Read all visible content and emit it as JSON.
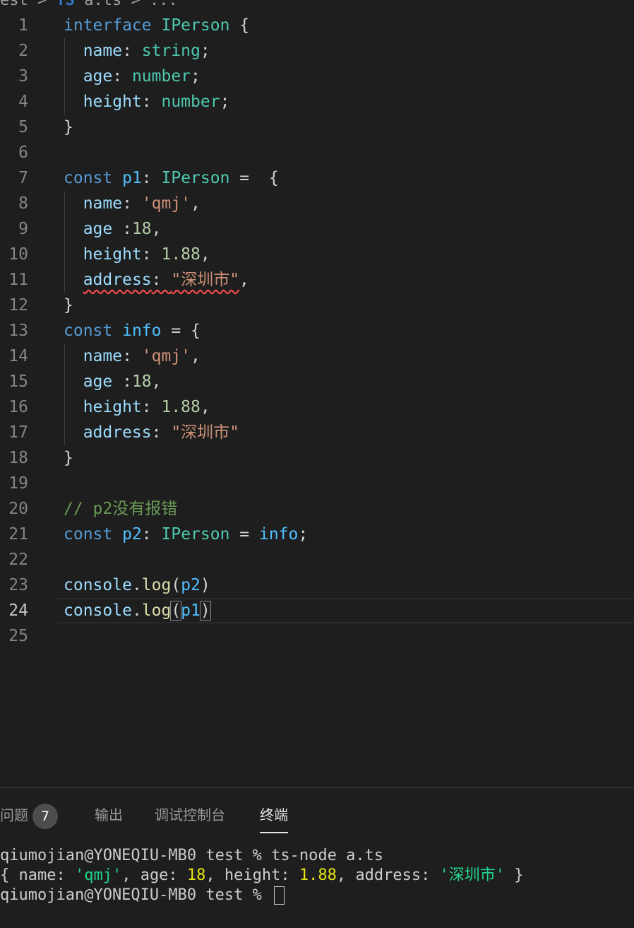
{
  "breadcrumb": {
    "folder": "est",
    "sep1": ">",
    "lang_icon": "TS",
    "file": "a.ts",
    "sep2": ">",
    "more": "..."
  },
  "editor": {
    "lines": [
      {
        "n": "1",
        "t": [
          [
            "kw",
            "interface "
          ],
          [
            "ty",
            "IPerson"
          ],
          [
            "pc",
            " {"
          ]
        ]
      },
      {
        "n": "2",
        "t": [
          [
            "pr",
            "  name"
          ],
          [
            "pc",
            ": "
          ],
          [
            "ty",
            "string"
          ],
          [
            "pc",
            ";"
          ]
        ]
      },
      {
        "n": "3",
        "t": [
          [
            "pr",
            "  age"
          ],
          [
            "pc",
            ": "
          ],
          [
            "ty",
            "number"
          ],
          [
            "pc",
            ";"
          ]
        ]
      },
      {
        "n": "4",
        "t": [
          [
            "pr",
            "  height"
          ],
          [
            "pc",
            ": "
          ],
          [
            "ty",
            "number"
          ],
          [
            "pc",
            ";"
          ]
        ]
      },
      {
        "n": "5",
        "t": [
          [
            "pc",
            "}"
          ]
        ]
      },
      {
        "n": "6",
        "t": []
      },
      {
        "n": "7",
        "t": [
          [
            "kw",
            "const "
          ],
          [
            "vr",
            "p1"
          ],
          [
            "pc",
            ": "
          ],
          [
            "ty",
            "IPerson"
          ],
          [
            "pc",
            " =  {"
          ]
        ]
      },
      {
        "n": "8",
        "t": [
          [
            "pr",
            "  name"
          ],
          [
            "pc",
            ": "
          ],
          [
            "st",
            "'qmj'"
          ],
          [
            "pc",
            ","
          ]
        ]
      },
      {
        "n": "9",
        "t": [
          [
            "pr",
            "  age "
          ],
          [
            "pc",
            ":"
          ],
          [
            "nm",
            "18"
          ],
          [
            "pc",
            ","
          ]
        ]
      },
      {
        "n": "10",
        "t": [
          [
            "pr",
            "  height"
          ],
          [
            "pc",
            ": "
          ],
          [
            "nm",
            "1.88"
          ],
          [
            "pc",
            ","
          ]
        ]
      },
      {
        "n": "11",
        "t": [
          [
            "pc",
            "  "
          ],
          [
            "pr err",
            "address"
          ],
          [
            "pc err",
            ": "
          ],
          [
            "st err",
            "\"深圳市\""
          ],
          [
            "pc",
            ","
          ]
        ]
      },
      {
        "n": "12",
        "t": [
          [
            "pc",
            "}"
          ]
        ]
      },
      {
        "n": "13",
        "t": [
          [
            "kw",
            "const "
          ],
          [
            "vr",
            "info"
          ],
          [
            "pc",
            " = {"
          ]
        ]
      },
      {
        "n": "14",
        "t": [
          [
            "pr",
            "  name"
          ],
          [
            "pc",
            ": "
          ],
          [
            "st",
            "'qmj'"
          ],
          [
            "pc",
            ","
          ]
        ]
      },
      {
        "n": "15",
        "t": [
          [
            "pr",
            "  age "
          ],
          [
            "pc",
            ":"
          ],
          [
            "nm",
            "18"
          ],
          [
            "pc",
            ","
          ]
        ]
      },
      {
        "n": "16",
        "t": [
          [
            "pr",
            "  height"
          ],
          [
            "pc",
            ": "
          ],
          [
            "nm",
            "1.88"
          ],
          [
            "pc",
            ","
          ]
        ]
      },
      {
        "n": "17",
        "t": [
          [
            "pr",
            "  address"
          ],
          [
            "pc",
            ": "
          ],
          [
            "st",
            "\"深圳市\""
          ]
        ]
      },
      {
        "n": "18",
        "t": [
          [
            "pc",
            "}"
          ]
        ]
      },
      {
        "n": "19",
        "t": []
      },
      {
        "n": "20",
        "t": [
          [
            "cm",
            "// p2没有报错"
          ]
        ]
      },
      {
        "n": "21",
        "t": [
          [
            "kw",
            "const "
          ],
          [
            "vr",
            "p2"
          ],
          [
            "pc",
            ": "
          ],
          [
            "ty",
            "IPerson"
          ],
          [
            "pc",
            " = "
          ],
          [
            "vr",
            "info"
          ],
          [
            "pc",
            ";"
          ]
        ]
      },
      {
        "n": "22",
        "t": []
      },
      {
        "n": "23",
        "t": [
          [
            "pr",
            "console"
          ],
          [
            "pc",
            "."
          ],
          [
            "fn",
            "log"
          ],
          [
            "pc",
            "("
          ],
          [
            "vr",
            "p2"
          ],
          [
            "pc",
            ")"
          ]
        ]
      },
      {
        "n": "24",
        "t": [
          [
            "pr",
            "console"
          ],
          [
            "pc",
            "."
          ],
          [
            "fn",
            "log"
          ],
          [
            "pc bm",
            "("
          ],
          [
            "vr",
            "p1"
          ],
          [
            "pc bm",
            ")"
          ]
        ]
      },
      {
        "n": "25",
        "t": []
      }
    ]
  },
  "panel": {
    "tabs": [
      {
        "label": "问题",
        "badge": "7"
      },
      {
        "label": "输出"
      },
      {
        "label": "调试控制台"
      },
      {
        "label": "终端",
        "active": true
      }
    ],
    "terminal": {
      "line1": "qiumojian@YONEQIU-MB0 test % ts-node a.ts",
      "line2_parts": [
        [
          "",
          "{ name: "
        ],
        [
          "tgreen",
          "'qmj'"
        ],
        [
          "",
          ", age: "
        ],
        [
          "tyellow",
          "18"
        ],
        [
          "",
          ", height: "
        ],
        [
          "tyellow",
          "1.88"
        ],
        [
          "",
          ", address: "
        ],
        [
          "tgreen",
          "'深圳市'"
        ],
        [
          "",
          " }"
        ]
      ],
      "line3": "qiumojian@YONEQIU-MB0 test % "
    }
  }
}
